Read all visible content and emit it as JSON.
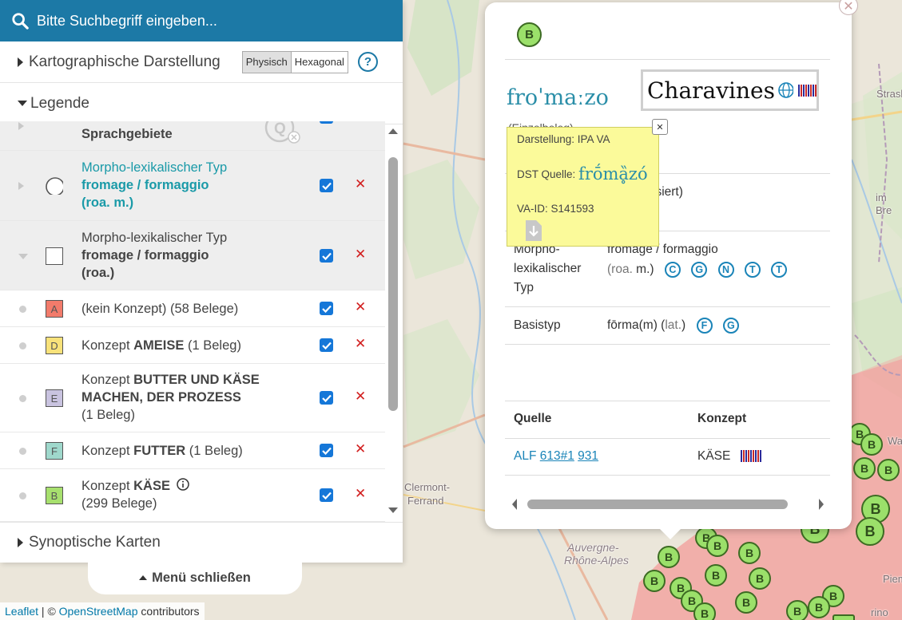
{
  "search": {
    "placeholder": "Bitte Suchbegriff eingeben..."
  },
  "sections": {
    "cartography": "Kartographische Darstellung",
    "physisch": "Physisch",
    "hexagonal": "Hexagonal",
    "help": "?",
    "legend": "Legende",
    "synoptic": "Synoptische Karten",
    "close_menu": "Menü schließen"
  },
  "legend": [
    {
      "line1": "",
      "line2": "Sprachgebiete"
    },
    {
      "line1": "Morpho-lexikalischer Typ",
      "line2": "fromage / formaggio",
      "line3": "(roa. m.)"
    },
    {
      "line1": "Morpho-lexikalischer Typ",
      "line2": "fromage / formaggio",
      "line3": "(roa.)"
    },
    {
      "symbol": "A",
      "pre": "(kein Konzept) (58 Belege)",
      "color": "#f27b6b"
    },
    {
      "symbol": "D",
      "pre": "Konzept ",
      "bold": "AMEISE",
      "post": " (1 Beleg)",
      "color": "#f8e27a"
    },
    {
      "symbol": "E",
      "pre": "Konzept ",
      "bold": "BUTTER UND KÄSE",
      "bold2": "MACHEN, DER PROZESS",
      "post": "(1 Beleg)",
      "color": "#c9c3e0"
    },
    {
      "symbol": "F",
      "pre": "Konzept ",
      "bold": "FUTTER",
      "post": " (1 Beleg)",
      "color": "#9fd8cc"
    },
    {
      "symbol": "B",
      "pre": "Konzept ",
      "bold": "KÄSE",
      "post": "(299 Belege)",
      "color": "#a7e06e"
    }
  ],
  "attribution": {
    "leaflet": "Leaflet",
    "sep": " | © ",
    "osm": "OpenStreetMap",
    "rest": " contributors"
  },
  "map_labels": {
    "clermont": "Clermont-",
    "ferrand": "Ferrand",
    "auvergne": "Auvergne-",
    "rhone": "Rhône-Alpes",
    "strasbo": "Strasbo",
    "wall": "Wall",
    "imbre": "im Bre",
    "piemo": "Piemo",
    "rino": "rino"
  },
  "popup": {
    "marker": "B",
    "ipa": "froˈmaːzo",
    "place": "Charavines",
    "einzelbeleg": "(Einzelbeleg)",
    "quantisiert": "isiert)",
    "morpho_label1": "Morpho-",
    "morpho_label2": "lexikalischer",
    "morpho_label3": "Typ",
    "morpho_value": "fromage / formaggio",
    "morpho_lang": "(roa.",
    "morpho_lang2": " m.)",
    "morpho_tags": [
      "C",
      "G",
      "N",
      "T",
      "T"
    ],
    "basis_label": "Basistyp",
    "basis_value": "fōrma(m) (",
    "basis_lang": "lat.",
    "basis_close": ")",
    "basis_tags": [
      "F",
      "G"
    ],
    "col_quelle": "Quelle",
    "col_konzept": "Konzept",
    "row_quelle_a": "ALF",
    "row_quelle_b": "613#1",
    "row_quelle_c": "931",
    "row_konzept": "KÄSE"
  },
  "tooltip": {
    "darstellung": "Darstellung: IPA VA",
    "dst_label": "DST Quelle: ",
    "dst_value": "frṓmḁ̏zó",
    "vaid": "VA-ID: S141593"
  },
  "colors": {
    "accent": "#1c79a6",
    "checkbox": "#1577d8",
    "remove": "#d21f1f",
    "marker": "#9be06a",
    "tooltip": "#fbfa9a"
  }
}
